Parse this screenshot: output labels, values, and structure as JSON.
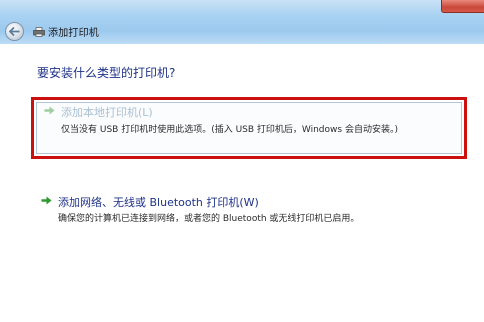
{
  "window": {
    "title": "添加打印机"
  },
  "main": {
    "heading": "要安装什么类型的打印机?",
    "options": [
      {
        "title": "添加本地打印机(L)",
        "description": "仅当没有 USB 打印机时使用此选项。(插入 USB 打印机后，Windows 会自动安装。)",
        "selected": true
      },
      {
        "title": "添加网络、无线或 Bluetooth 打印机(W)",
        "description": "确保您的计算机已连接到网络，或者您的 Bluetooth 或无线打印机已启用。",
        "selected": false
      }
    ]
  },
  "colors": {
    "highlight_border": "#cc1010",
    "heading_text": "#1e3287",
    "arrow_green": "#2e9a2e"
  }
}
